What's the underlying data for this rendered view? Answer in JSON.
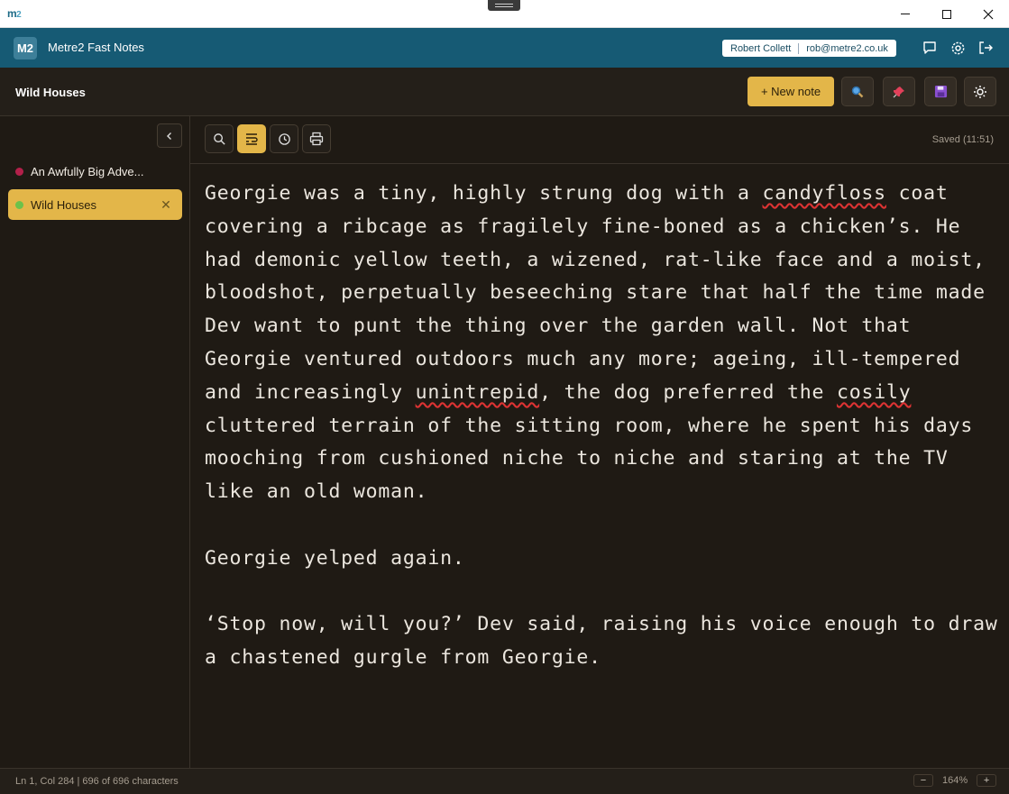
{
  "window": {
    "logo": "m",
    "logo_sup": "2"
  },
  "app": {
    "badge": "M2",
    "title": "Metre2 Fast Notes",
    "user_name": "Robert Collett",
    "user_email": "rob@metre2.co.uk"
  },
  "toolbar": {
    "note_title": "Wild Houses",
    "new_note_label": "+ New note"
  },
  "sidebar": {
    "items": [
      {
        "label": "An Awfully Big Adve...",
        "dot_color": "#b3204a"
      },
      {
        "label": "Wild Houses",
        "dot_color": "#6cc24a",
        "close": "✕"
      }
    ]
  },
  "editor": {
    "saved": "Saved (11:51)",
    "p1_a": "Georgie was a tiny, highly strung dog with a ",
    "p1_sq1": "candyfloss",
    "p1_b": " coat covering a ribcage as fragilely fine-boned as a chicken’s. He had demonic yellow teeth, a wizened, rat-like face and a moist, bloodshot, perpetually beseeching stare that half the time made Dev want to punt the thing over the garden wall. Not that Georgie ventured outdoors much any more; ageing, ill-tempered and increasingly ",
    "p1_sq2": "unintrepid",
    "p1_c": ", the dog preferred the ",
    "p1_sq3": "cosily",
    "p1_d": " cluttered terrain of the sitting room, where he spent his days mooching from cushioned niche to niche and staring at the TV like an old woman.",
    "p2": "Georgie yelped again.",
    "p3": "‘Stop now, will you?’ Dev said, raising his voice enough to draw a chastened gurgle from Georgie."
  },
  "status": {
    "position": "Ln 1, Col 284 | 696 of 696 characters",
    "zoom": "164%",
    "zoom_out": "−",
    "zoom_in": "+"
  },
  "colors": {
    "accent": "#e3b649",
    "header": "#165a74",
    "background": "#1f1a14"
  }
}
